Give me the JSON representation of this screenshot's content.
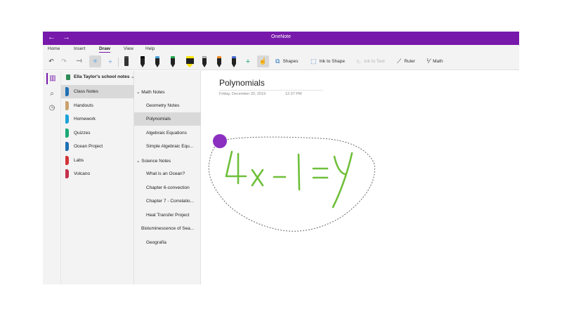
{
  "titlebar": {
    "title": "OneNote",
    "back_icon": "back-arrow-icon",
    "forward_icon": "forward-arrow-icon",
    "color": "#7719aa"
  },
  "menu": {
    "items": [
      "Home",
      "Insert",
      "Draw",
      "View",
      "Help"
    ],
    "active": "Draw"
  },
  "toolbar": {
    "pens": [
      {
        "cap": "#000000",
        "body": "#222222"
      },
      {
        "cap": "#4aa3df",
        "body": "#222222"
      },
      {
        "cap": "#20a84a",
        "body": "#222222"
      },
      {
        "cap": "#ffe600",
        "body": "#222222"
      },
      {
        "cap": "#e8e8e8",
        "body": "#222222"
      },
      {
        "cap": "#f08a24",
        "body": "#222222"
      },
      {
        "cap": "#4a6fd8",
        "body": "#222222"
      }
    ],
    "shapes_label": "Shapes",
    "ink_to_shape_label": "Ink to Shape",
    "ink_to_text_label": "Ink to Text",
    "ruler_label": "Ruler",
    "math_label": "Math"
  },
  "notebook": {
    "name": "Ella Taylor's school notes"
  },
  "sections": [
    {
      "label": "Class Notes",
      "color": "#1f6fb5",
      "selected": true
    },
    {
      "label": "Handouts",
      "color": "#c9a26b",
      "selected": false
    },
    {
      "label": "Homework",
      "color": "#1aa3d9",
      "selected": false
    },
    {
      "label": "Quizzes",
      "color": "#19a974",
      "selected": false
    },
    {
      "label": "Ocean Project",
      "color": "#1f6fb5",
      "selected": false
    },
    {
      "label": "Labs",
      "color": "#d13438",
      "selected": false
    },
    {
      "label": "Volcano",
      "color": "#c4314b",
      "selected": false
    }
  ],
  "pages": [
    {
      "label": "Math Notes",
      "kind": "group",
      "selected": false
    },
    {
      "label": "Geometry Notes",
      "kind": "child",
      "selected": false
    },
    {
      "label": "Polynomials",
      "kind": "child",
      "selected": true
    },
    {
      "label": "Algebraic Equations",
      "kind": "child",
      "selected": false
    },
    {
      "label": "Simple Algebraic Equ...",
      "kind": "child",
      "selected": false
    },
    {
      "label": "Science Notes",
      "kind": "group",
      "selected": false
    },
    {
      "label": "What is an Ocean?",
      "kind": "child",
      "selected": false
    },
    {
      "label": "Chapter 6-convection",
      "kind": "child",
      "selected": false
    },
    {
      "label": "Chapter 7 - Correlatio...",
      "kind": "child",
      "selected": false
    },
    {
      "label": "Heat Transfer Project",
      "kind": "child",
      "selected": false
    },
    {
      "label": "Bioluminescence of Sea...",
      "kind": "sub",
      "selected": false
    },
    {
      "label": "Geografía",
      "kind": "child",
      "selected": false
    }
  ],
  "page": {
    "title": "Polynomials",
    "date": "Friday, December 20, 2019",
    "time": "12:37 PM",
    "ink_color": "#6fbf3a",
    "selection_handle_color": "#8a2fbf"
  }
}
